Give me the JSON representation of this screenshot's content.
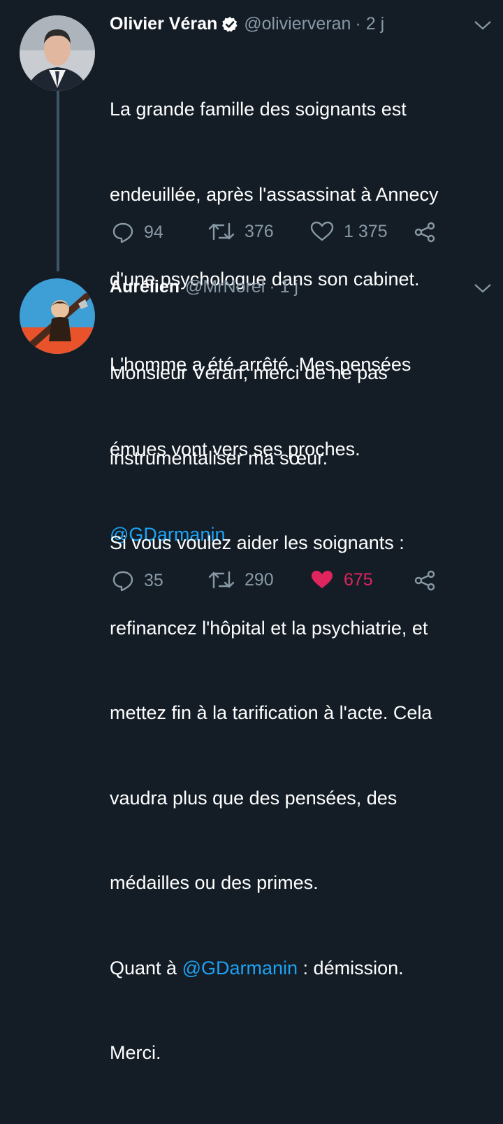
{
  "tweets": [
    {
      "name": "Olivier Véran",
      "verified": true,
      "handle": "@olivierveran",
      "time": "· 2 j",
      "body_lines": [
        "La grande famille des soignants est",
        "endeuillée, après l'assassinat à Annecy",
        "d'une psychologue dans son cabinet.",
        "L'homme a été arrêté. Mes pensées",
        "émues vont vers ses proches."
      ],
      "mention": "@GDarmanin",
      "replies": "94",
      "retweets": "376",
      "likes": "1 375",
      "liked": false
    },
    {
      "name": "Aurélien",
      "verified": false,
      "handle": "@MrNorel",
      "time": "· 1 j",
      "body_lines": [
        "Monsieur Véran, merci de ne pas",
        "instrumentaliser ma sœur.",
        "Si vous voulez aider les soignants :",
        "refinancez l'hôpital et la psychiatrie, et",
        "mettez fin à la tarification à l'acte. Cela",
        "vaudra plus que des pensées, des",
        "médailles ou des primes."
      ],
      "quant_prefix": "Quant à ",
      "mention": "@GDarmanin",
      "quant_suffix": " : démission.",
      "closing": "Merci.",
      "replies": "35",
      "retweets": "290",
      "likes": "675",
      "liked": true
    }
  ],
  "colors": {
    "background": "#141d26",
    "muted": "#8899a6",
    "link": "#1da1f2",
    "like": "#e0245e",
    "thread_line": "#3d5466"
  }
}
